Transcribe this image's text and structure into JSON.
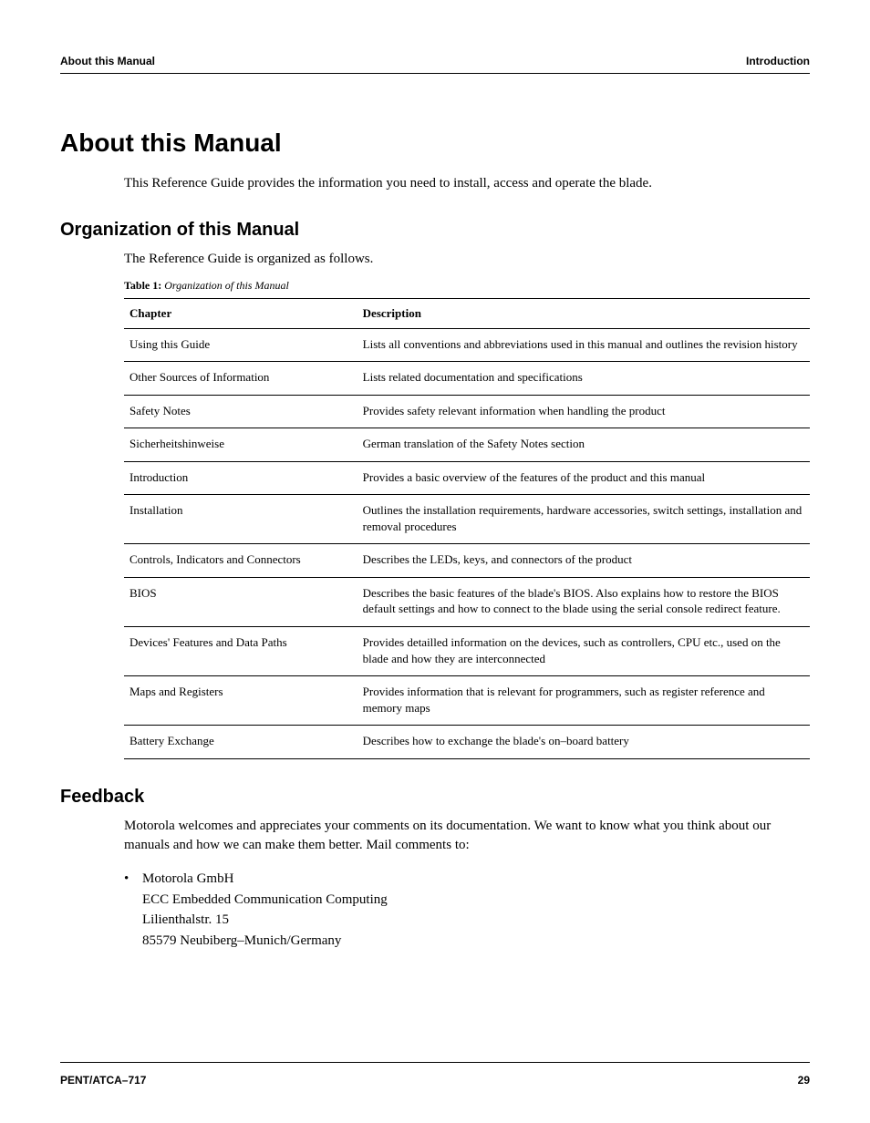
{
  "header": {
    "left": "About this Manual",
    "right": "Introduction"
  },
  "title": "About this Manual",
  "intro": "This Reference Guide provides the information you need to install, access and operate the blade.",
  "org": {
    "heading": "Organization of this Manual",
    "para": "The Reference Guide is organized as follows.",
    "caption_bold": "Table 1:",
    "caption_ital": "Organization of this Manual",
    "col1": "Chapter",
    "col2": "Description",
    "rows": [
      {
        "c": "Using this Guide",
        "d": "Lists all conventions and abbreviations used in this manual and outlines the revision history"
      },
      {
        "c": "Other Sources of Information",
        "d": "Lists related documentation and specifications"
      },
      {
        "c": "Safety Notes",
        "d": "Provides safety relevant information when handling the product"
      },
      {
        "c": "Sicherheitshinweise",
        "d": "German translation of the Safety Notes section"
      },
      {
        "c": "Introduction",
        "d": "Provides a basic overview of the features of the product and this manual"
      },
      {
        "c": "Installation",
        "d": "Outlines the installation requirements, hardware accessories, switch settings, installation and removal procedures"
      },
      {
        "c": "Controls, Indicators and Connectors",
        "d": "Describes the LEDs, keys, and connectors of the product"
      },
      {
        "c": "BIOS",
        "d": "Describes the basic features of the blade's BIOS. Also explains how to restore the BIOS default settings and how to connect to the blade using the serial console redirect feature."
      },
      {
        "c": "Devices' Features and Data Paths",
        "d": "Provides detailled information on the devices, such as controllers, CPU etc., used on the blade and how they are interconnected"
      },
      {
        "c": "Maps and Registers",
        "d": "Provides information that is relevant for programmers, such as register reference and memory maps"
      },
      {
        "c": "Battery Exchange",
        "d": "Describes how to exchange the blade's on–board battery"
      }
    ]
  },
  "feedback": {
    "heading": "Feedback",
    "para": "Motorola welcomes and appreciates your comments on its documentation. We want to know what you think about our manuals and how we can make them better. Mail comments to:",
    "address": {
      "l1": "Motorola GmbH",
      "l2": "ECC Embedded Communication Computing",
      "l3": "Lilienthalstr. 15",
      "l4": "85579 Neubiberg–Munich/Germany"
    }
  },
  "footer": {
    "left": "PENT/ATCA–717",
    "right": "29"
  }
}
